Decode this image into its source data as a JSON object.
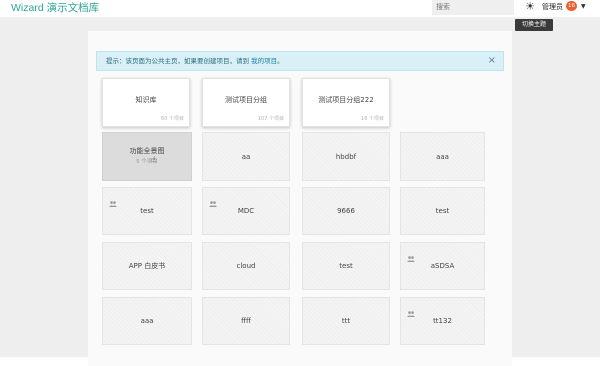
{
  "header": {
    "brand": "Wizard 演示文档库",
    "search_placeholder": "搜索",
    "theme_tooltip": "切换主题",
    "user_label": "管理员",
    "badge_count": "16",
    "theme_icon": "sun-icon",
    "caret_icon": "caret-down-icon"
  },
  "notice": {
    "prefix": "提示：该页面为公共主页，如果要创建项目，请到 ",
    "link": "我的项目",
    "suffix": "。",
    "close": "×"
  },
  "projects": [
    {
      "title": "知识库",
      "count": "60 个项目",
      "state": "raised"
    },
    {
      "title": "测试项目分组",
      "count": "107 个项目",
      "state": "raised"
    },
    {
      "title": "测试项目分组222",
      "count": "16 个项目",
      "state": "raised"
    },
    {
      "title": "功能全景图",
      "count": "5 个项目",
      "state": "hover"
    },
    {
      "title": "aa",
      "icon": false
    },
    {
      "title": "hbdbf",
      "icon": false
    },
    {
      "title": "aaa",
      "icon": false
    },
    {
      "title": "test",
      "icon": true
    },
    {
      "title": "MDC",
      "icon": true
    },
    {
      "title": "9666",
      "icon": false
    },
    {
      "title": "test",
      "icon": false
    },
    {
      "title": "APP 白皮书",
      "icon": false
    },
    {
      "title": "cloud",
      "icon": false
    },
    {
      "title": "test",
      "icon": false
    },
    {
      "title": "aSDSA",
      "icon": true
    },
    {
      "title": "aaa",
      "icon": false
    },
    {
      "title": "ffff",
      "icon": false
    },
    {
      "title": "ttt",
      "icon": false
    },
    {
      "title": "tt132",
      "icon": true
    }
  ],
  "colors": {
    "brand": "#2fa596",
    "badge": "#e8602d",
    "notice_bg": "#d9f0f6"
  }
}
